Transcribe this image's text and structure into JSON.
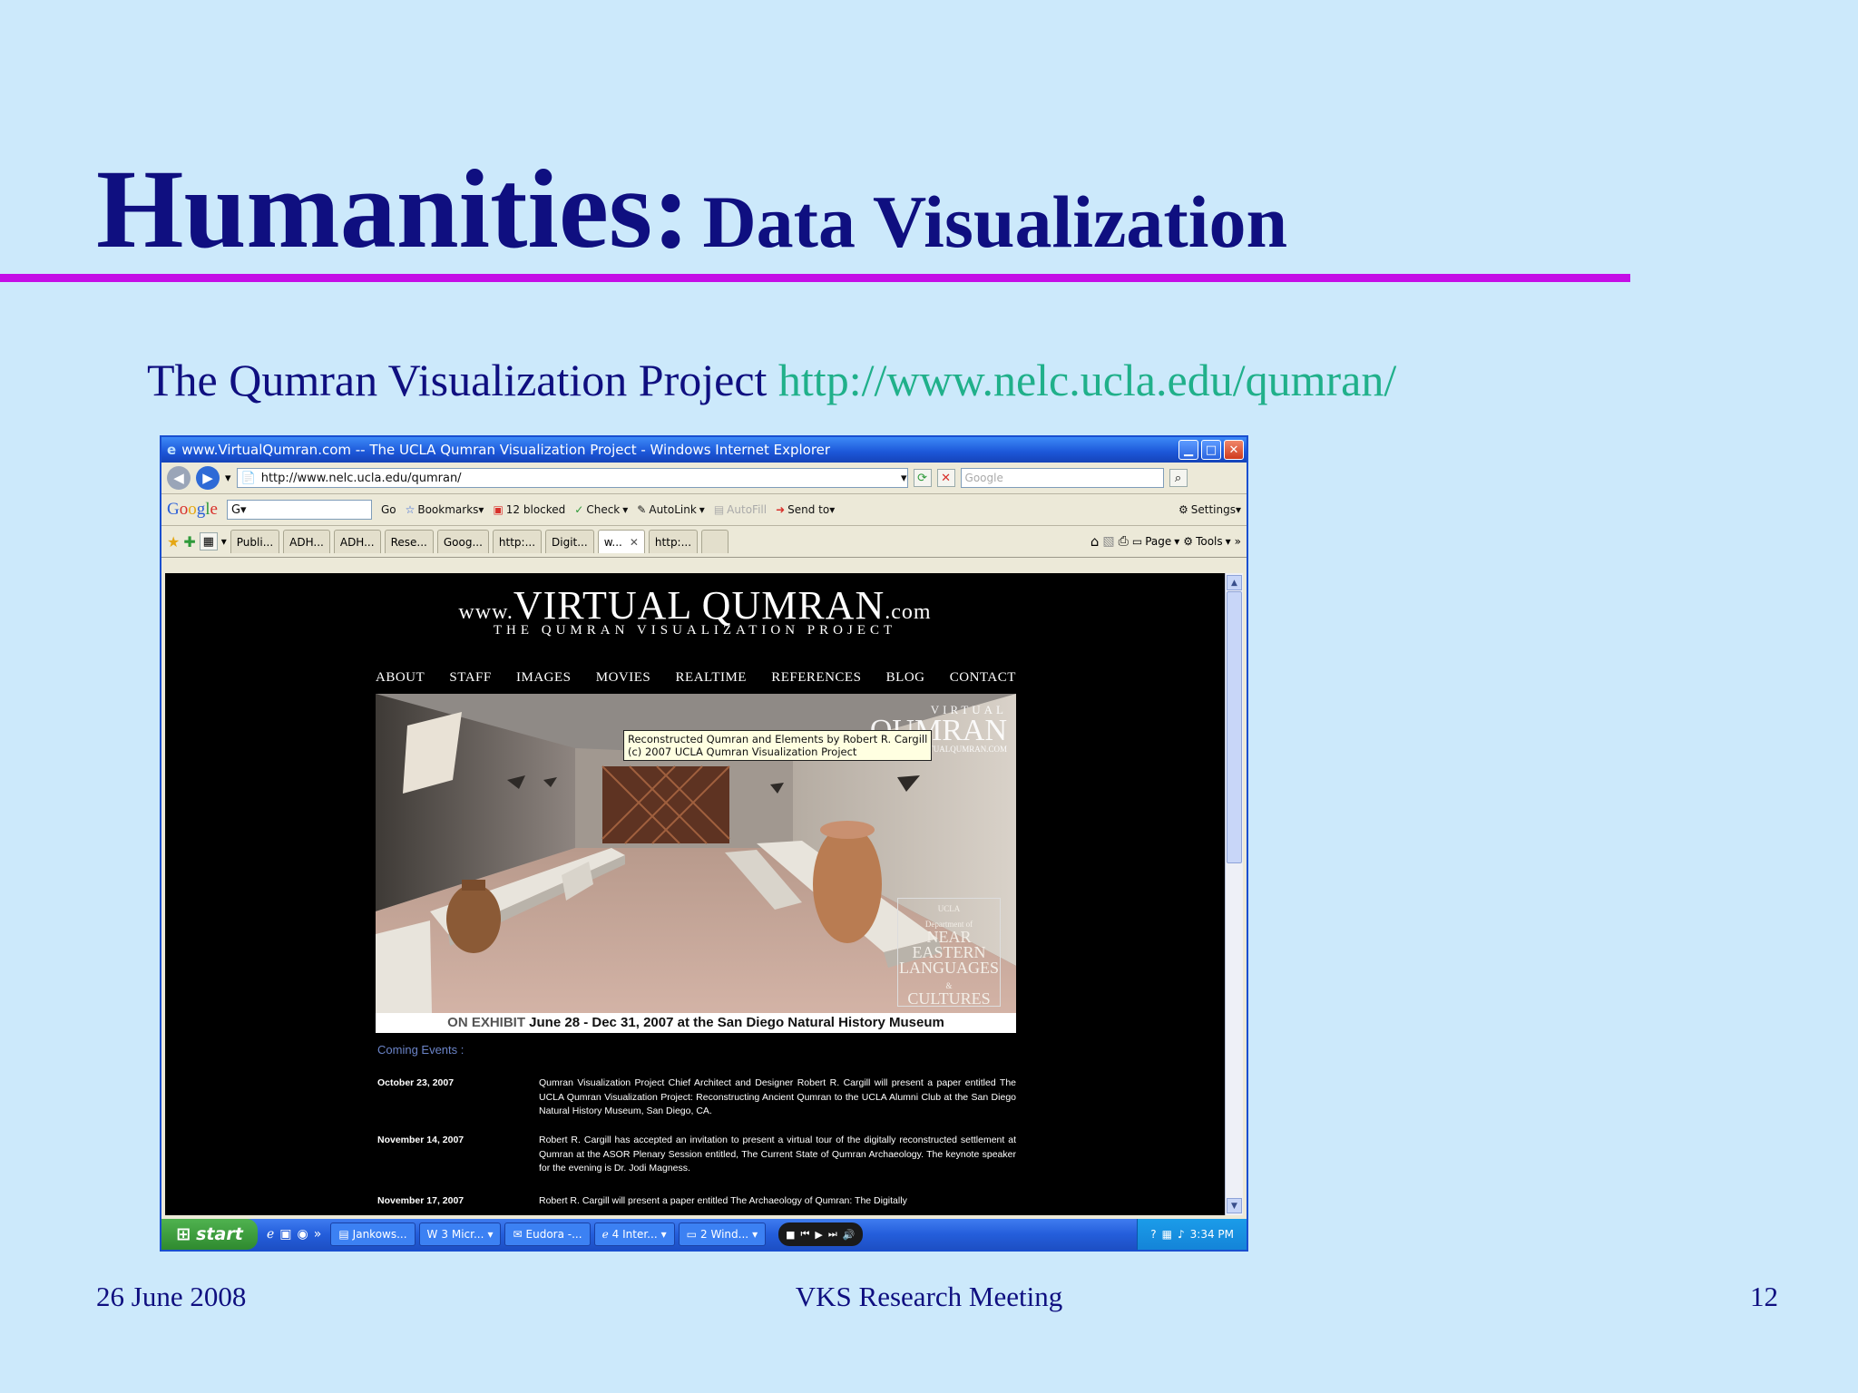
{
  "slide": {
    "title_main": "Humanities:",
    "title_sub": "Data Visualization",
    "subtitle_text": "The Qumran Visualization Project",
    "subtitle_link": "http://www.nelc.ucla.edu/qumran/",
    "footer_date": "26 June 2008",
    "footer_center": "VKS Research Meeting",
    "footer_page": "12",
    "colors": {
      "title": "#0f0f80",
      "rule": "#c40ee6",
      "link": "#20b08a",
      "background": "#cce9fb"
    }
  },
  "browser": {
    "window_title": "www.VirtualQumran.com -- The UCLA Qumran Visualization Project - Windows Internet Explorer",
    "address": "http://www.nelc.ucla.edu/qumran/",
    "search_placeholder": "Google",
    "google_toolbar": {
      "logo": "Google",
      "box_value": "G▾",
      "go": "Go",
      "bookmarks": "Bookmarks▾",
      "blocked": "12 blocked",
      "check": "Check",
      "autolink": "AutoLink",
      "autofill": "AutoFill",
      "send_to": "Send to▾",
      "settings": "Settings▾"
    },
    "tabs": [
      {
        "label": "Publi..."
      },
      {
        "label": "ADH..."
      },
      {
        "label": "ADH..."
      },
      {
        "label": "Rese..."
      },
      {
        "label": "Goog..."
      },
      {
        "label": "http:..."
      },
      {
        "label": "Digit..."
      },
      {
        "label": "w..."
      },
      {
        "label": "http:..."
      }
    ],
    "command_bar": {
      "page": "Page",
      "tools": "Tools"
    }
  },
  "site": {
    "logo_www": "www.",
    "logo_name": "VIRTUAL QUMRAN",
    "logo_tld": ".com",
    "tagline": "THE QUMRAN VISUALIZATION PROJECT",
    "nav": [
      "ABOUT",
      "STAFF",
      "IMAGES",
      "MOVIES",
      "REALTIME",
      "REFERENCES",
      "BLOG",
      "CONTACT"
    ],
    "hero_watermark": {
      "small": "VIRTUAL",
      "big": "QUMRAN",
      "url": "VIRTUALQUMRAN.COM"
    },
    "tooltip_line1": "Reconstructed Qumran and Elements by Robert R. Cargill",
    "tooltip_line2": "(c) 2007 UCLA Qumran Visualization Project",
    "dept": {
      "line1": "UCLA",
      "line2": "Department of",
      "line3": "NEAR",
      "line4": "EASTERN",
      "line5": "LANGUAGES",
      "line6": "&",
      "line7": "CULTURES"
    },
    "exhibit_label": "ON EXHIBIT",
    "exhibit_text": "June 28 - Dec 31, 2007 at the San Diego Natural History Museum",
    "coming_events": "Coming Events :",
    "events": [
      {
        "date": "October 23, 2007",
        "text": "Qumran Visualization Project Chief Architect and Designer Robert R. Cargill will present a paper entitled The UCLA Qumran Visualization Project: Reconstructing Ancient Qumran to the UCLA Alumni Club at the San Diego Natural History Museum, San Diego, CA."
      },
      {
        "date": "November 14, 2007",
        "text": "Robert R. Cargill has accepted an invitation to present a virtual tour of the digitally reconstructed settlement at Qumran at the ASOR Plenary Session entitled, The Current State of Qumran Archaeology. The keynote speaker for the evening is Dr. Jodi Magness."
      },
      {
        "date": "November 17, 2007",
        "text": "Robert R. Cargill will present a paper entitled The Archaeology of Qumran: The Digitally"
      }
    ]
  },
  "taskbar": {
    "start": "start",
    "tasks": [
      {
        "label": "Jankows..."
      },
      {
        "label": "3 Micr..."
      },
      {
        "label": "Eudora -..."
      },
      {
        "label": "4 Inter..."
      },
      {
        "label": "2 Wind..."
      }
    ],
    "clock": "3:34 PM"
  }
}
